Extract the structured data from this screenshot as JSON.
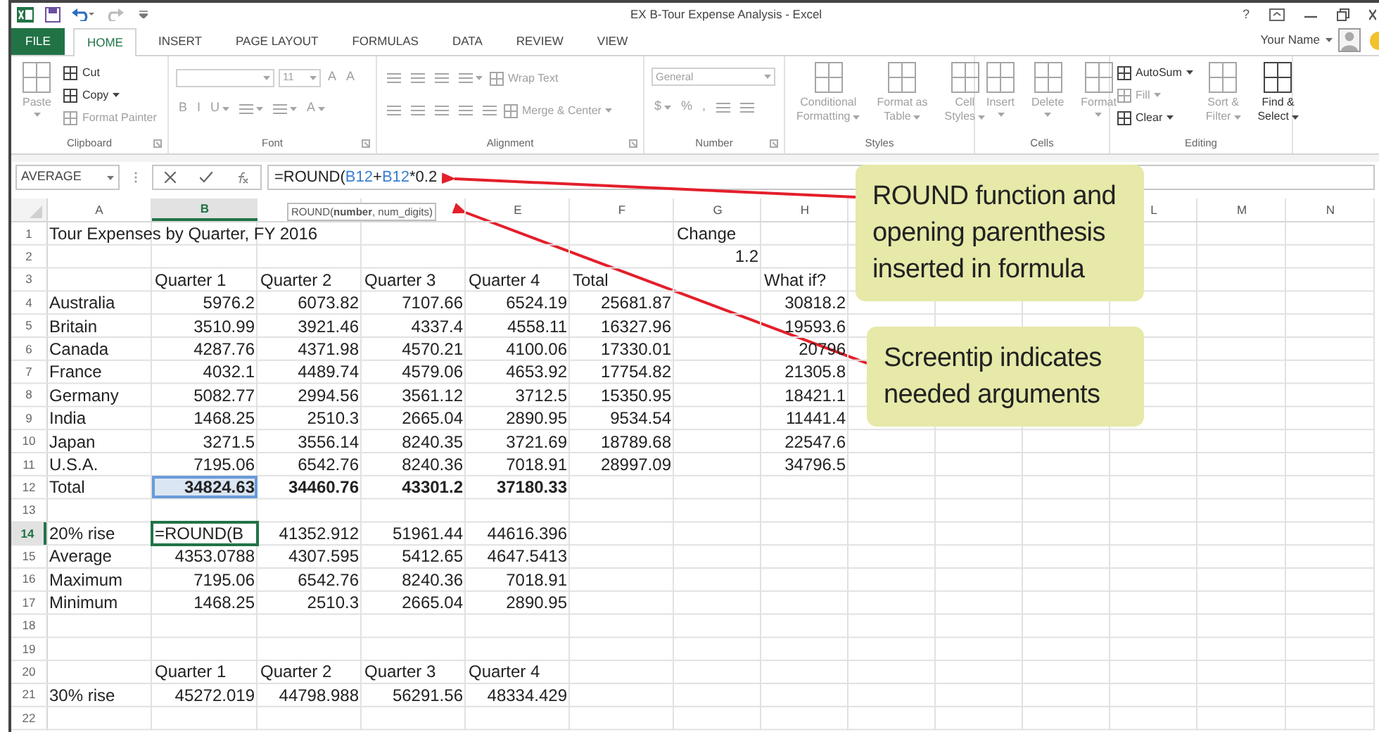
{
  "window": {
    "title": "EX B-Tour Expense Analysis - Excel",
    "help": "?",
    "user": "Your Name"
  },
  "tabs": [
    {
      "label": "FILE",
      "kind": "file",
      "selected": false
    },
    {
      "label": "HOME",
      "kind": "tab",
      "selected": true
    },
    {
      "label": "INSERT",
      "kind": "tab",
      "selected": false
    },
    {
      "label": "PAGE LAYOUT",
      "kind": "tab",
      "selected": false
    },
    {
      "label": "FORMULAS",
      "kind": "tab",
      "selected": false
    },
    {
      "label": "DATA",
      "kind": "tab",
      "selected": false
    },
    {
      "label": "REVIEW",
      "kind": "tab",
      "selected": false
    },
    {
      "label": "VIEW",
      "kind": "tab",
      "selected": false
    }
  ],
  "ribbon": {
    "groups": [
      {
        "label": "Clipboard",
        "launcher": true,
        "lines": [
          [
            {
              "kind": "large",
              "lines": [
                "Paste"
              ],
              "dropdown": true,
              "disabled": true
            }
          ],
          [
            {
              "kind": "small",
              "label": "Cut",
              "disabled": false
            },
            {
              "kind": "small",
              "label": "Copy",
              "dropdown": true,
              "disabled": false
            },
            {
              "kind": "small",
              "label": "Format Painter",
              "disabled": true
            }
          ]
        ]
      },
      {
        "label": "Font",
        "launcher": true,
        "lines": [
          [
            {
              "kind": "field",
              "dropdown": true,
              "disabled": true
            },
            {
              "kind": "field",
              "value": "11",
              "dropdown": true,
              "disabled": true
            },
            {
              "kind": "glyph",
              "label": "A",
              "disabled": true
            },
            {
              "kind": "glyph",
              "label": "A",
              "disabled": true
            }
          ],
          [
            {
              "kind": "glyph",
              "label": "B",
              "disabled": true
            },
            {
              "kind": "glyph",
              "label": "I",
              "disabled": true
            },
            {
              "kind": "glyph",
              "label": "U",
              "dropdown": true,
              "disabled": true
            },
            {
              "kind": "icon",
              "dropdown": true,
              "disabled": true
            },
            {
              "kind": "icon",
              "dropdown": true,
              "disabled": true
            },
            {
              "kind": "glyph",
              "label": "A",
              "dropdown": true,
              "disabled": true
            }
          ]
        ]
      },
      {
        "label": "Alignment",
        "launcher": true,
        "lines": [
          [
            {
              "kind": "icon",
              "disabled": true
            },
            {
              "kind": "icon",
              "disabled": true
            },
            {
              "kind": "icon",
              "disabled": true
            },
            {
              "kind": "icon",
              "dropdown": true,
              "disabled": true
            },
            {
              "kind": "small",
              "label": "Wrap Text",
              "disabled": true
            }
          ],
          [
            {
              "kind": "icon",
              "disabled": true
            },
            {
              "kind": "icon",
              "disabled": true
            },
            {
              "kind": "icon",
              "disabled": true
            },
            {
              "kind": "icon",
              "disabled": true
            },
            {
              "kind": "icon",
              "disabled": true
            },
            {
              "kind": "small",
              "label": "Merge & Center",
              "dropdown": true,
              "disabled": true
            }
          ]
        ]
      },
      {
        "label": "Number",
        "launcher": true,
        "lines": [
          [
            {
              "kind": "field",
              "value": "General",
              "dropdown": true,
              "disabled": true
            }
          ],
          [
            {
              "kind": "glyph",
              "label": "$",
              "dropdown": true,
              "disabled": true
            },
            {
              "kind": "glyph",
              "label": "%",
              "disabled": true
            },
            {
              "kind": "glyph",
              "label": ",",
              "disabled": true
            },
            {
              "kind": "icon",
              "disabled": true
            },
            {
              "kind": "icon",
              "disabled": true
            }
          ]
        ]
      },
      {
        "label": "Styles",
        "lines": [
          [
            {
              "kind": "large",
              "lines": [
                "Conditional",
                "Formatting"
              ],
              "dropdown": true,
              "disabled": true
            }
          ],
          [
            {
              "kind": "large",
              "lines": [
                "Format as",
                "Table"
              ],
              "dropdown": true,
              "disabled": true
            }
          ],
          [
            {
              "kind": "large",
              "lines": [
                "Cell",
                "Styles"
              ],
              "dropdown": true,
              "disabled": true
            }
          ]
        ]
      },
      {
        "label": "Cells",
        "lines": [
          [
            {
              "kind": "large",
              "lines": [
                "Insert"
              ],
              "dropdown": true,
              "disabled": true
            }
          ],
          [
            {
              "kind": "large",
              "lines": [
                "Delete"
              ],
              "dropdown": true,
              "disabled": true
            }
          ],
          [
            {
              "kind": "large",
              "lines": [
                "Format"
              ],
              "dropdown": true,
              "disabled": true
            }
          ]
        ]
      },
      {
        "label": "Editing",
        "lines": [
          [
            {
              "kind": "small",
              "label": "AutoSum",
              "dropdown": true,
              "disabled": false
            },
            {
              "kind": "small",
              "label": "Fill",
              "dropdown": true,
              "disabled": true
            },
            {
              "kind": "small",
              "label": "Clear",
              "dropdown": true,
              "disabled": false
            }
          ],
          [
            {
              "kind": "large",
              "lines": [
                "Sort &",
                "Filter"
              ],
              "dropdown": true,
              "disabled": true
            }
          ],
          [
            {
              "kind": "large",
              "lines": [
                "Find &",
                "Select"
              ],
              "dropdown": true,
              "disabled": false
            }
          ]
        ]
      }
    ]
  },
  "formula_bar": {
    "name_box": "AVERAGE",
    "formula": [
      {
        "kind": "plain",
        "text": "=ROUND("
      },
      {
        "kind": "ref",
        "text": "B12"
      },
      {
        "kind": "plain",
        "text": "+"
      },
      {
        "kind": "ref",
        "text": "B12"
      },
      {
        "kind": "plain",
        "text": "*0.2"
      }
    ],
    "screentip": "ROUND(**number**, num_digits)"
  },
  "columns": [
    {
      "label": "A",
      "selected": false
    },
    {
      "label": "B",
      "selected": true
    },
    {
      "selected": false
    },
    {
      "selected": false
    },
    {
      "label": "E",
      "selected": false
    },
    {
      "label": "F",
      "selected": false
    },
    {
      "label": "G",
      "selected": false
    },
    {
      "label": "H",
      "selected": false
    },
    {
      "selected": false
    },
    {},
    {},
    {
      "label": "L",
      "selected": false
    },
    {
      "label": "M",
      "selected": false
    },
    {
      "label": "N",
      "selected": false
    }
  ],
  "rows": [
    {
      "number": "1",
      "selected": false,
      "cells": {
        "A": {
          "kind": "text",
          "value": "Tour Expenses by Quarter, FY 2016"
        },
        "G": {
          "kind": "text",
          "value": "Change"
        }
      }
    },
    {
      "number": "2",
      "selected": false,
      "cells": {
        "G": {
          "kind": "number",
          "value": "1.2"
        }
      }
    },
    {
      "number": "3",
      "selected": false,
      "cells": {
        "B": {
          "kind": "text",
          "value": "Quarter 1"
        },
        "C": {
          "kind": "text",
          "value": "Quarter 2"
        },
        "D": {
          "kind": "text",
          "value": "Quarter 3"
        },
        "E": {
          "kind": "text",
          "value": "Quarter 4"
        },
        "F": {
          "kind": "text",
          "value": "Total"
        },
        "H": {
          "kind": "text",
          "value": "What if?"
        }
      }
    },
    {
      "number": "4",
      "selected": false,
      "cells": {
        "A": {
          "kind": "text",
          "value": "Australia"
        },
        "B": {
          "kind": "number",
          "value": "5976.2"
        },
        "C": {
          "kind": "number",
          "value": "6073.82"
        },
        "D": {
          "kind": "number",
          "value": "7107.66"
        },
        "E": {
          "kind": "number",
          "value": "6524.19"
        },
        "F": {
          "kind": "number",
          "value": "25681.87"
        },
        "H": {
          "kind": "number",
          "value": "30818.2"
        }
      }
    },
    {
      "number": "5",
      "selected": false,
      "cells": {
        "A": {
          "kind": "text",
          "value": "Britain"
        },
        "B": {
          "kind": "number",
          "value": "3510.99"
        },
        "C": {
          "kind": "number",
          "value": "3921.46"
        },
        "D": {
          "kind": "number",
          "value": "4337.4"
        },
        "E": {
          "kind": "number",
          "value": "4558.11"
        },
        "F": {
          "kind": "number",
          "value": "16327.96"
        },
        "H": {
          "kind": "number",
          "value": "19593.6"
        }
      }
    },
    {
      "number": "6",
      "selected": false,
      "cells": {
        "A": {
          "kind": "text",
          "value": "Canada"
        },
        "B": {
          "kind": "number",
          "value": "4287.76"
        },
        "C": {
          "kind": "number",
          "value": "4371.98"
        },
        "D": {
          "kind": "number",
          "value": "4570.21"
        },
        "E": {
          "kind": "number",
          "value": "4100.06"
        },
        "F": {
          "kind": "number",
          "value": "17330.01"
        },
        "H": {
          "kind": "number",
          "value": "20796"
        }
      }
    },
    {
      "number": "7",
      "selected": false,
      "cells": {
        "A": {
          "kind": "text",
          "value": "France"
        },
        "B": {
          "kind": "number",
          "value": "4032.1"
        },
        "C": {
          "kind": "number",
          "value": "4489.74"
        },
        "D": {
          "kind": "number",
          "value": "4579.06"
        },
        "E": {
          "kind": "number",
          "value": "4653.92"
        },
        "F": {
          "kind": "number",
          "value": "17754.82"
        },
        "H": {
          "kind": "number",
          "value": "21305.8"
        }
      }
    },
    {
      "number": "8",
      "selected": false,
      "cells": {
        "A": {
          "kind": "text",
          "value": "Germany"
        },
        "B": {
          "kind": "number",
          "value": "5082.77"
        },
        "C": {
          "kind": "number",
          "value": "2994.56"
        },
        "D": {
          "kind": "number",
          "value": "3561.12"
        },
        "E": {
          "kind": "number",
          "value": "3712.5"
        },
        "F": {
          "kind": "number",
          "value": "15350.95"
        },
        "H": {
          "kind": "number",
          "value": "18421.1"
        }
      }
    },
    {
      "number": "9",
      "selected": false,
      "cells": {
        "A": {
          "kind": "text",
          "value": "India"
        },
        "B": {
          "kind": "number",
          "value": "1468.25"
        },
        "C": {
          "kind": "number",
          "value": "2510.3"
        },
        "D": {
          "kind": "number",
          "value": "2665.04"
        },
        "E": {
          "kind": "number",
          "value": "2890.95"
        },
        "F": {
          "kind": "number",
          "value": "9534.54"
        },
        "H": {
          "kind": "number",
          "value": "11441.4"
        }
      }
    },
    {
      "number": "10",
      "selected": false,
      "cells": {
        "A": {
          "kind": "text",
          "value": "Japan"
        },
        "B": {
          "kind": "number",
          "value": "3271.5"
        },
        "C": {
          "kind": "number",
          "value": "3556.14"
        },
        "D": {
          "kind": "number",
          "value": "8240.35"
        },
        "E": {
          "kind": "number",
          "value": "3721.69"
        },
        "F": {
          "kind": "number",
          "value": "18789.68"
        },
        "H": {
          "kind": "number",
          "value": "22547.6"
        }
      }
    },
    {
      "number": "11",
      "selected": false,
      "cells": {
        "A": {
          "kind": "text",
          "value": "U.S.A."
        },
        "B": {
          "kind": "number",
          "value": "7195.06"
        },
        "C": {
          "kind": "number",
          "value": "6542.76"
        },
        "D": {
          "kind": "number",
          "value": "8240.36"
        },
        "E": {
          "kind": "number",
          "value": "7018.91"
        },
        "F": {
          "kind": "number",
          "value": "28997.09"
        },
        "H": {
          "kind": "number",
          "value": "34796.5"
        }
      }
    },
    {
      "number": "12",
      "selected": false,
      "cells": {
        "A": {
          "kind": "text",
          "value": "Total"
        },
        "B": {
          "kind": "number",
          "value": "34824.63",
          "bold": true,
          "referenced": true
        },
        "C": {
          "kind": "number",
          "value": "34460.76",
          "bold": true
        },
        "D": {
          "kind": "number",
          "value": "43301.2",
          "bold": true
        },
        "E": {
          "kind": "number",
          "value": "37180.33",
          "bold": true
        }
      }
    },
    {
      "number": "13",
      "selected": false,
      "cells": {}
    },
    {
      "number": "14",
      "selected": true,
      "cells": {
        "A": {
          "kind": "text",
          "value": "20% rise"
        },
        "B": {
          "kind": "text",
          "value": "=ROUND(B",
          "active": true
        },
        "C": {
          "kind": "number",
          "value": "41352.912"
        },
        "D": {
          "kind": "number",
          "value": "51961.44"
        },
        "E": {
          "kind": "number",
          "value": "44616.396"
        }
      }
    },
    {
      "number": "15",
      "selected": false,
      "cells": {
        "A": {
          "kind": "text",
          "value": "Average"
        },
        "B": {
          "kind": "number",
          "value": "4353.0788"
        },
        "C": {
          "kind": "number",
          "value": "4307.595"
        },
        "D": {
          "kind": "number",
          "value": "5412.65"
        },
        "E": {
          "kind": "number",
          "value": "4647.5413"
        }
      }
    },
    {
      "number": "16",
      "selected": false,
      "cells": {
        "A": {
          "kind": "text",
          "value": "Maximum"
        },
        "B": {
          "kind": "number",
          "value": "7195.06"
        },
        "C": {
          "kind": "number",
          "value": "6542.76"
        },
        "D": {
          "kind": "number",
          "value": "8240.36"
        },
        "E": {
          "kind": "number",
          "value": "7018.91"
        }
      }
    },
    {
      "number": "17",
      "selected": false,
      "cells": {
        "A": {
          "kind": "text",
          "value": "Minimum"
        },
        "B": {
          "kind": "number",
          "value": "1468.25"
        },
        "C": {
          "kind": "number",
          "value": "2510.3"
        },
        "D": {
          "kind": "number",
          "value": "2665.04"
        },
        "E": {
          "kind": "number",
          "value": "2890.95"
        }
      }
    },
    {
      "number": "18",
      "selected": false,
      "cells": {}
    },
    {
      "number": "19",
      "selected": false,
      "cells": {}
    },
    {
      "number": "20",
      "selected": false,
      "cells": {
        "B": {
          "kind": "text",
          "value": "Quarter 1"
        },
        "C": {
          "kind": "text",
          "value": "Quarter 2"
        },
        "D": {
          "kind": "text",
          "value": "Quarter 3"
        },
        "E": {
          "kind": "text",
          "value": "Quarter 4"
        }
      }
    },
    {
      "number": "21",
      "selected": false,
      "cells": {
        "A": {
          "kind": "text",
          "value": "30% rise"
        },
        "B": {
          "kind": "number",
          "value": "45272.019"
        },
        "C": {
          "kind": "number",
          "value": "44798.988"
        },
        "D": {
          "kind": "number",
          "value": "56291.56"
        },
        "E": {
          "kind": "number",
          "value": "48334.429"
        }
      }
    },
    {
      "number": "22",
      "selected": false,
      "cells": {}
    }
  ],
  "callouts": [
    {
      "text": "ROUND function and opening parenthesis inserted in formula"
    },
    {
      "text": "Screentip indicates needed arguments"
    }
  ]
}
